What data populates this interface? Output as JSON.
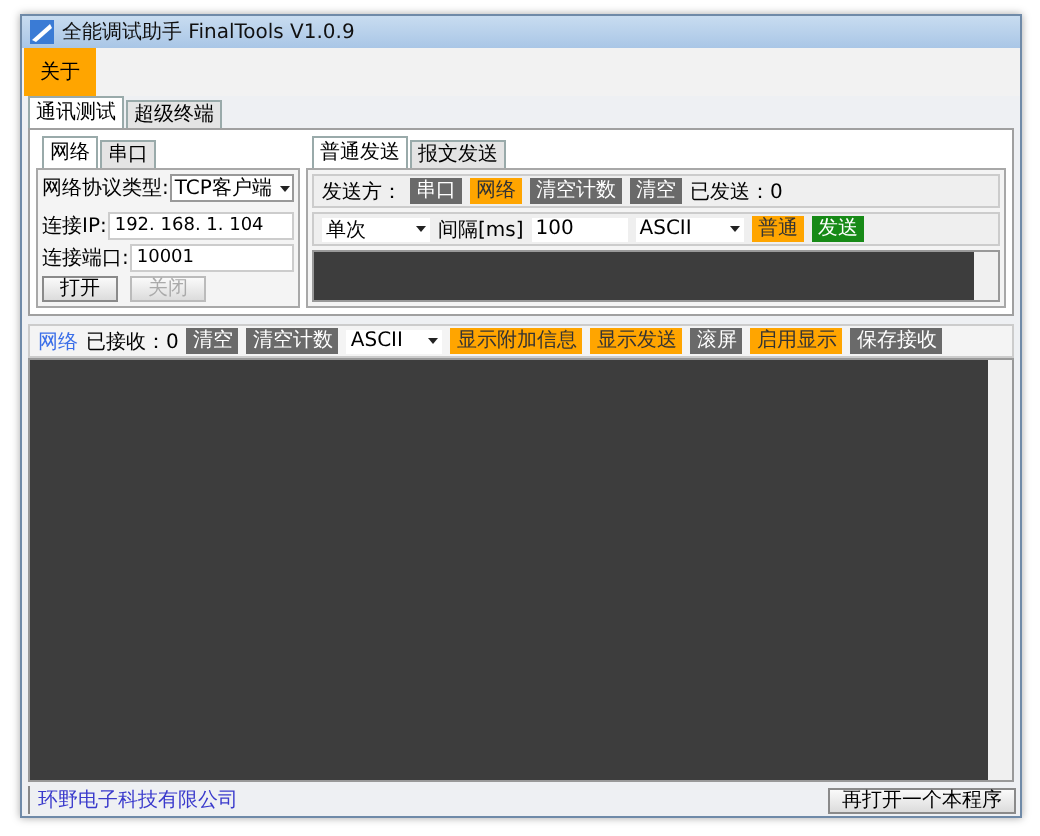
{
  "window": {
    "title": "全能调试助手 FinalTools V1.0.9"
  },
  "menu": [
    {
      "label": "关于",
      "selected": true
    }
  ],
  "main_tabs": [
    {
      "label": "通讯测试",
      "selected": true
    },
    {
      "label": "超级终端",
      "selected": false
    }
  ],
  "connection": {
    "tabs": [
      {
        "label": "网络",
        "selected": true
      },
      {
        "label": "串口",
        "selected": false
      }
    ],
    "protocol_label": "网络协议类型:",
    "protocol_value": "TCP客户端",
    "ip_label": "连接IP:",
    "ip_value": "192. 168. 1. 104",
    "port_label": "连接端口:",
    "port_value": "10001",
    "buttons": [
      {
        "label": "打开",
        "disabled": false
      },
      {
        "label": "关闭",
        "disabled": true
      }
    ]
  },
  "send": {
    "tabs": [
      {
        "label": "普通发送",
        "selected": true
      },
      {
        "label": "报文发送",
        "selected": false
      }
    ],
    "target_label": "发送方：",
    "toolbar": [
      {
        "kind": "toggle",
        "label": "串口",
        "on": false
      },
      {
        "kind": "toggle",
        "label": "网络",
        "on": true
      },
      {
        "kind": "action",
        "label": "清空计数"
      },
      {
        "kind": "action",
        "label": "清空"
      },
      {
        "kind": "text",
        "label": "已发送：0"
      }
    ],
    "mode": "单次",
    "interval_label": "间隔[ms]",
    "interval_value": "100",
    "encoding": "ASCII",
    "mode_button": "普通",
    "send_button": "发送"
  },
  "receive": {
    "toolbar": [
      {
        "kind": "link",
        "label": "网络"
      },
      {
        "kind": "text",
        "label": "已接收：0"
      },
      {
        "kind": "action",
        "label": "清空"
      },
      {
        "kind": "action",
        "label": "清空计数"
      },
      {
        "kind": "select",
        "label": "ASCII"
      },
      {
        "kind": "toggle",
        "label": "显示附加信息",
        "on": true
      },
      {
        "kind": "toggle",
        "label": "显示发送",
        "on": true
      },
      {
        "kind": "toggle",
        "label": "滚屏",
        "on": false
      },
      {
        "kind": "toggle",
        "label": "启用显示",
        "on": true
      },
      {
        "kind": "action",
        "label": "保存接收"
      }
    ]
  },
  "status_bar": {
    "company": "环野电子科技有限公司",
    "button": "再打开一个本程序"
  }
}
